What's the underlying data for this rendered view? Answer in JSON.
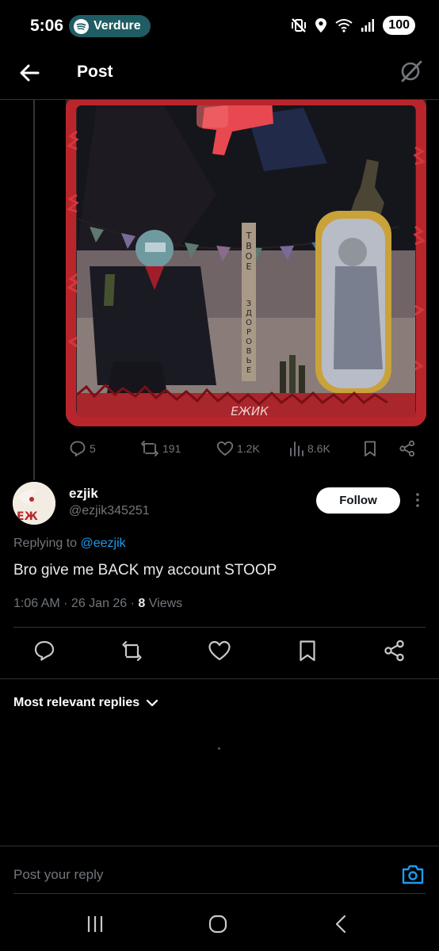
{
  "status_bar": {
    "time": "5:06",
    "app_pill": "Verdure",
    "battery": "100",
    "icons": [
      "mute-vibrate-icon",
      "location-icon",
      "wifi-icon",
      "signal-icon"
    ]
  },
  "header": {
    "title": "Post",
    "back_icon": "arrow-left-icon",
    "grok_icon": "grok-icon"
  },
  "parent_post": {
    "media_text": {
      "vertical": [
        "Т",
        "В",
        "О",
        "Е"
      ],
      "vertical2": [
        "З",
        "Д",
        "О",
        "Р",
        "О",
        "В",
        "Ь",
        "Е"
      ],
      "signature": "EЖИК"
    },
    "actions": {
      "replies": "5",
      "reposts": "191",
      "likes": "1.2K",
      "views": "8.6K"
    }
  },
  "reply_post": {
    "display_name": "ezjik",
    "handle": "@ezjik345251",
    "follow_label": "Follow",
    "replying_prefix": "Replying to ",
    "replying_to": "@eezjik",
    "text": "Bro give me BACK my account STOOP",
    "time": "1:06 AM · 26 Jan 26 · ",
    "views_count": "8",
    "views_label": " Views"
  },
  "sort": {
    "label": "Most relevant replies"
  },
  "composer": {
    "placeholder": "Post your reply"
  },
  "colors": {
    "background": "#000000",
    "accent": "#1d9bf0",
    "muted": "#71767b",
    "divider": "#2f3336"
  }
}
